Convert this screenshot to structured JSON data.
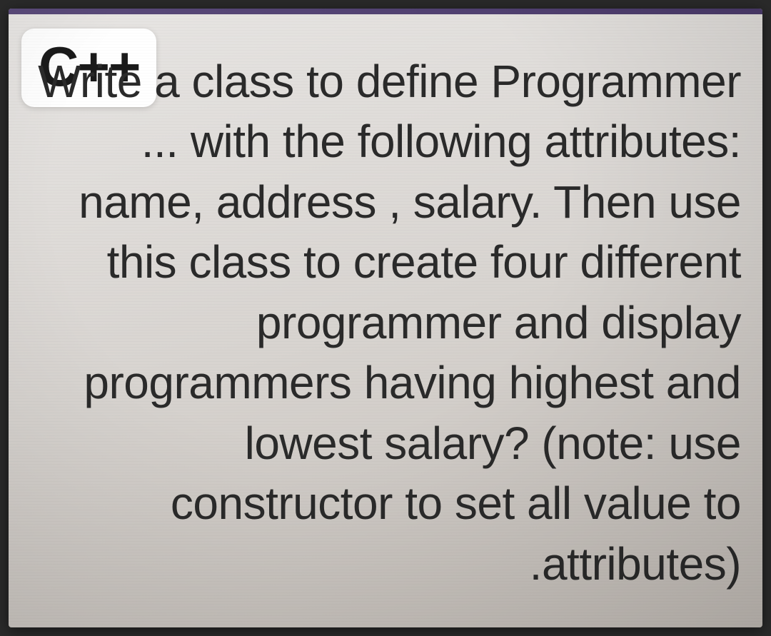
{
  "badge": {
    "label": "C++"
  },
  "question": {
    "text": "Write a class to define Programmer ... with the following attributes: name, address , salary. Then use this class to create four different programmer and display programmers having highest and lowest salary? (note: use constructor to set all value to .attributes)"
  }
}
